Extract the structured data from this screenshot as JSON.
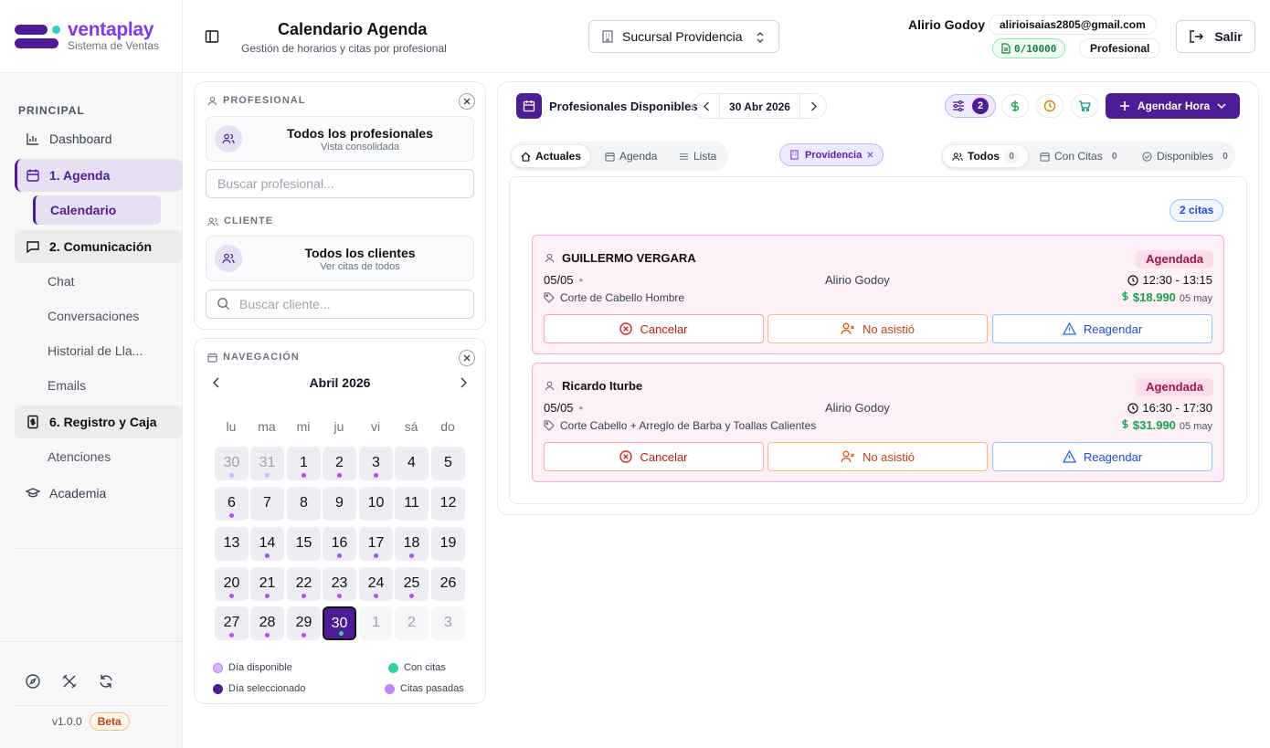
{
  "brand": {
    "name": "ventaplay",
    "subtitle": "Sistema de Ventas"
  },
  "sidebar": {
    "section": "PRINCIPAL",
    "items": [
      {
        "label": "Dashboard",
        "icon": "bar-chart-icon"
      },
      {
        "label": "1. Agenda",
        "icon": "calendar-icon",
        "active": true
      },
      {
        "label": "Calendario",
        "sub": true,
        "active": true
      },
      {
        "label": "2. Comunicación",
        "icon": "message-icon"
      },
      {
        "label": "Chat",
        "sub": true
      },
      {
        "label": "Conversaciones",
        "sub": true
      },
      {
        "label": "Historial de Lla...",
        "sub": true
      },
      {
        "label": "Emails",
        "sub": true
      },
      {
        "label": "6. Registro y Caja",
        "icon": "cash-register-icon"
      },
      {
        "label": "Atenciones",
        "sub": true
      },
      {
        "label": "Academia",
        "icon": "graduation-cap-icon"
      }
    ],
    "version": "v1.0.0",
    "badge": "Beta"
  },
  "header": {
    "title": "Calendario Agenda",
    "subtitle": "Gestión de horarios y citas por profesional",
    "branch": "Sucursal Providencia",
    "user_name": "Alirio Godoy",
    "user_email": "alirioisaias2805@gmail.com",
    "quota": "0/10000",
    "role": "Profesional",
    "logout": "Salir"
  },
  "filters": {
    "professional_label": "PROFESIONAL",
    "professional_title": "Todos los profesionales",
    "professional_sub": "Vista consolidada",
    "professional_placeholder": "Buscar profesional...",
    "client_label": "CLIENTE",
    "client_title": "Todos los clientes",
    "client_sub": "Ver citas de todos",
    "client_placeholder": "Buscar cliente..."
  },
  "calendar": {
    "label": "NAVEGACIÓN",
    "month": "Abril 2026",
    "weekdays": [
      "lu",
      "ma",
      "mi",
      "ju",
      "vi",
      "sá",
      "do"
    ],
    "days": [
      {
        "d": "30",
        "other": true,
        "dot": true
      },
      {
        "d": "31",
        "other": true,
        "dot": true
      },
      {
        "d": "1",
        "dot": true
      },
      {
        "d": "2",
        "dot": true
      },
      {
        "d": "3",
        "dot": true
      },
      {
        "d": "4"
      },
      {
        "d": "5"
      },
      {
        "d": "6",
        "dot": true
      },
      {
        "d": "7"
      },
      {
        "d": "8"
      },
      {
        "d": "9"
      },
      {
        "d": "10"
      },
      {
        "d": "11"
      },
      {
        "d": "12"
      },
      {
        "d": "13"
      },
      {
        "d": "14",
        "dot": true
      },
      {
        "d": "15"
      },
      {
        "d": "16",
        "dot": true
      },
      {
        "d": "17",
        "dot": true
      },
      {
        "d": "18",
        "dot": true
      },
      {
        "d": "19"
      },
      {
        "d": "20",
        "dot": true
      },
      {
        "d": "21",
        "dot": true
      },
      {
        "d": "22",
        "dot": true
      },
      {
        "d": "23",
        "dot": true
      },
      {
        "d": "24",
        "dot": true
      },
      {
        "d": "25",
        "dot": true
      },
      {
        "d": "26"
      },
      {
        "d": "27",
        "dot": true
      },
      {
        "d": "28",
        "dot": true
      },
      {
        "d": "29",
        "dot": true
      },
      {
        "d": "30",
        "selected": true,
        "dot": true
      },
      {
        "d": "1",
        "out": true
      },
      {
        "d": "2",
        "out": true
      },
      {
        "d": "3",
        "out": true
      }
    ],
    "legend": [
      {
        "label": "Día disponible",
        "color": "#d8b4fe"
      },
      {
        "label": "Con citas",
        "color": "#34d399"
      },
      {
        "label": "Día seleccionado",
        "color": "#4c1d95"
      },
      {
        "label": "Citas pasadas",
        "color": "#c084fc"
      }
    ]
  },
  "main": {
    "title": "Profesionales Disponibles",
    "date": "30 Abr 2026",
    "filter_count": "2",
    "schedule_button": "Agendar Hora",
    "views": [
      "Actuales",
      "Agenda",
      "Lista"
    ],
    "branch_chip": "Providencia",
    "status_tabs": [
      {
        "label": "Todos",
        "count": "0"
      },
      {
        "label": "Con Citas",
        "count": "0"
      },
      {
        "label": "Disponibles",
        "count": "0"
      }
    ],
    "appt_count": "2 citas",
    "appointments": [
      {
        "client": "GUILLERMO VERGARA",
        "status": "Agendada",
        "date": "05/05",
        "professional": "Alirio Godoy",
        "time": "12:30 - 13:15",
        "service": "Corte de Cabello Hombre",
        "price": "$18.990",
        "day": "05 may",
        "cancel": "Cancelar",
        "noshow": "No asistió",
        "reschedule": "Reagendar"
      },
      {
        "client": "Ricardo Iturbe",
        "status": "Agendada",
        "date": "05/05",
        "professional": "Alirio Godoy",
        "time": "16:30 - 17:30",
        "service": "Corte Cabello + Arreglo de Barba y Toallas Calientes",
        "price": "$31.990",
        "day": "05 may",
        "cancel": "Cancelar",
        "noshow": "No asistió",
        "reschedule": "Reagendar"
      }
    ]
  },
  "colors": {
    "primary": "#4c1d95",
    "accent": "#2dd4bf",
    "status": "#9d174d"
  }
}
